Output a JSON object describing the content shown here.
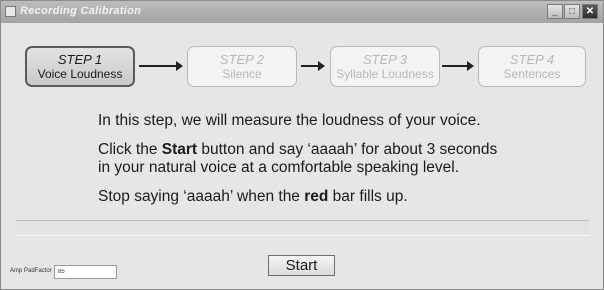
{
  "window": {
    "title": "Recording Calibration",
    "minimize_label": "_",
    "maximize_label": "□",
    "close_label": "✕"
  },
  "steps": [
    {
      "number": "STEP 1",
      "label": "Voice Loudness",
      "active": true
    },
    {
      "number": "STEP 2",
      "label": "Silence",
      "active": false
    },
    {
      "number": "STEP 3",
      "label": "Syllable Loudness",
      "active": false
    },
    {
      "number": "STEP 4",
      "label": "Sentences",
      "active": false
    }
  ],
  "instructions": {
    "intro": "In this step, we will measure the loudness of your voice.",
    "click_prefix": "Click the ",
    "click_bold": "Start",
    "click_suffix": " button and say ‘aaaah’ for about 3 seconds",
    "click_line2": "in your natural voice at a comfortable speaking level.",
    "stop_prefix": "Stop saying ‘aaaah’ when the ",
    "stop_bold": "red",
    "stop_suffix": " bar fills up."
  },
  "progress": {
    "fill": 0
  },
  "amp": {
    "label": "Amp PadFactor",
    "value": "85"
  },
  "start_button": "Start"
}
